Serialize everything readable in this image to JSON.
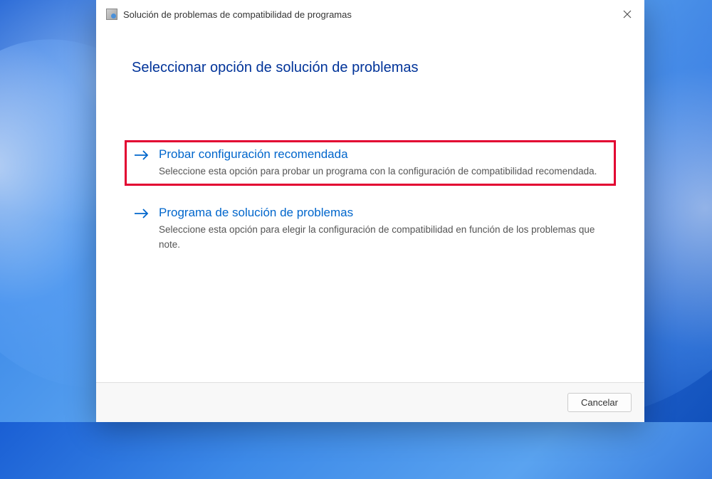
{
  "dialog": {
    "title": "Solución de problemas de compatibilidad de programas",
    "heading": "Seleccionar opción de solución de problemas"
  },
  "options": {
    "recommended": {
      "title": "Probar configuración recomendada",
      "description": "Seleccione esta opción para probar un programa con la configuración de compatibilidad recomendada."
    },
    "troubleshoot": {
      "title": "Programa de solución de problemas",
      "description": "Seleccione esta opción para elegir la configuración de compatibilidad en función de los problemas que note."
    }
  },
  "buttons": {
    "cancel": "Cancelar"
  }
}
